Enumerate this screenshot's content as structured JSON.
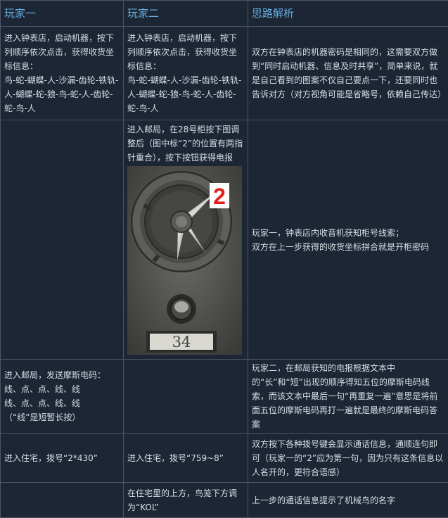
{
  "headers": [
    "玩家一",
    "玩家二",
    "思路解析"
  ],
  "rows": [
    {
      "p1": [
        "进入钟表店，启动机器，按下列顺序依次点击，获得收货坐标信息：",
        "鸟-蛇-蝴蝶-人-沙漏-齿轮-铁轨-人-蝴蝶-蛇-狼-鸟-蛇-人-齿轮-蛇-鸟-人"
      ],
      "p2": [
        "进入钟表店，启动机器，按下列顺序依次点击，获得收货坐标信息：",
        "鸟-蛇-蝴蝶-人-沙漏-齿轮-铁轨-人-蝴蝶-蛇-狼-鸟-蛇-人-齿轮-蛇-鸟-人"
      ],
      "analysis": [
        "双方在钟表店的机器密码是相同的，这需要双方做到“同时启动机器、信息及时共享”，简单来说，就是自己看到的图案不仅自己要点一下，还要同时也告诉对方（对方视角可能是省略号，依赖自己传达）"
      ]
    },
    {
      "p1": [],
      "p2": [
        "进入邮局，在28号柜按下图调整后（图中标“2”的位置有两指针重合），按下按钮获得电报"
      ],
      "image": {
        "marker": "2",
        "display": "34"
      },
      "analysis": [
        "玩家一，钟表店内收音机获知柜号线索；",
        "双方在上一步获得的收货坐标拼合就是开柜密码"
      ]
    },
    {
      "p1": [
        "进入邮局，发送摩斯电码：",
        "线、点、点、线、线",
        "线、点、点、线、线",
        "（“线”是短暂长按）"
      ],
      "p2": [],
      "analysis": [
        "玩家二，在邮局获知的电报根据文本中的“长”和“短”出现的顺序得知五位的摩斯电码线索，而该文本中最后一句“再重复一遍”意思是将前面五位的摩斯电码再打一遍就是最终的摩斯电码答案"
      ]
    },
    {
      "p1": [
        "进入住宅，拨号“2*430”"
      ],
      "p2": [
        "进入住宅，拨号“759~8”"
      ],
      "analysis": [
        "双方按下各种拨号键会显示通话信息，通顺连句即可（玩家一的“2”应为第一句，因为只有这条信息以人名开的，更符合语感）"
      ]
    },
    {
      "p1": [],
      "p2": [
        "在住宅里的上方，鸟笼下方调为“KOL”"
      ],
      "analysis": [
        "上一步的通话信息提示了机械鸟的名字"
      ]
    }
  ]
}
